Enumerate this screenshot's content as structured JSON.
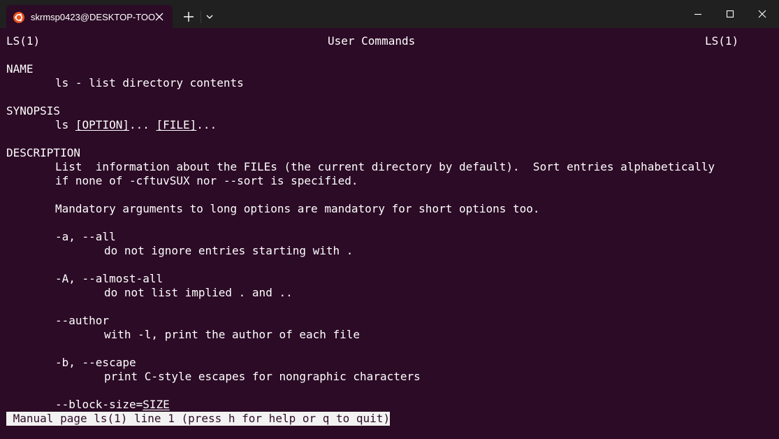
{
  "window": {
    "tab_title": "skrmsp0423@DESKTOP-TOO",
    "tab_icon": "ubuntu-icon",
    "accent": "#e95420",
    "background": "#2c0b26"
  },
  "man": {
    "header_left": "LS(1)",
    "header_center": "User Commands",
    "header_right": "LS(1)",
    "name_heading": "NAME",
    "name_text": "ls - list directory contents",
    "synopsis_heading": "SYNOPSIS",
    "synopsis_cmd": "ls ",
    "synopsis_option": "[OPTION]",
    "synopsis_mid": "... ",
    "synopsis_file": "[FILE]",
    "synopsis_end": "...",
    "description_heading": "DESCRIPTION",
    "desc_line1": "List  information about the FILEs (the current directory by default).  Sort entries alphabetically",
    "desc_line2": "if none of -cftuvSUX nor --sort is specified.",
    "desc_line3": "Mandatory arguments to long options are mandatory for short options too.",
    "options": [
      {
        "flag": "-a, --all",
        "desc": "do not ignore entries starting with ."
      },
      {
        "flag": "-A, --almost-all",
        "desc": "do not list implied . and .."
      },
      {
        "flag": "--author",
        "desc": "with -l, print the author of each file"
      },
      {
        "flag": "-b, --escape",
        "desc": "print C-style escapes for nongraphic characters"
      }
    ],
    "block_size_prefix": "--block-size=",
    "block_size_arg": "SIZE"
  },
  "status_line": " Manual page ls(1) line 1 (press h for help or q to quit)"
}
